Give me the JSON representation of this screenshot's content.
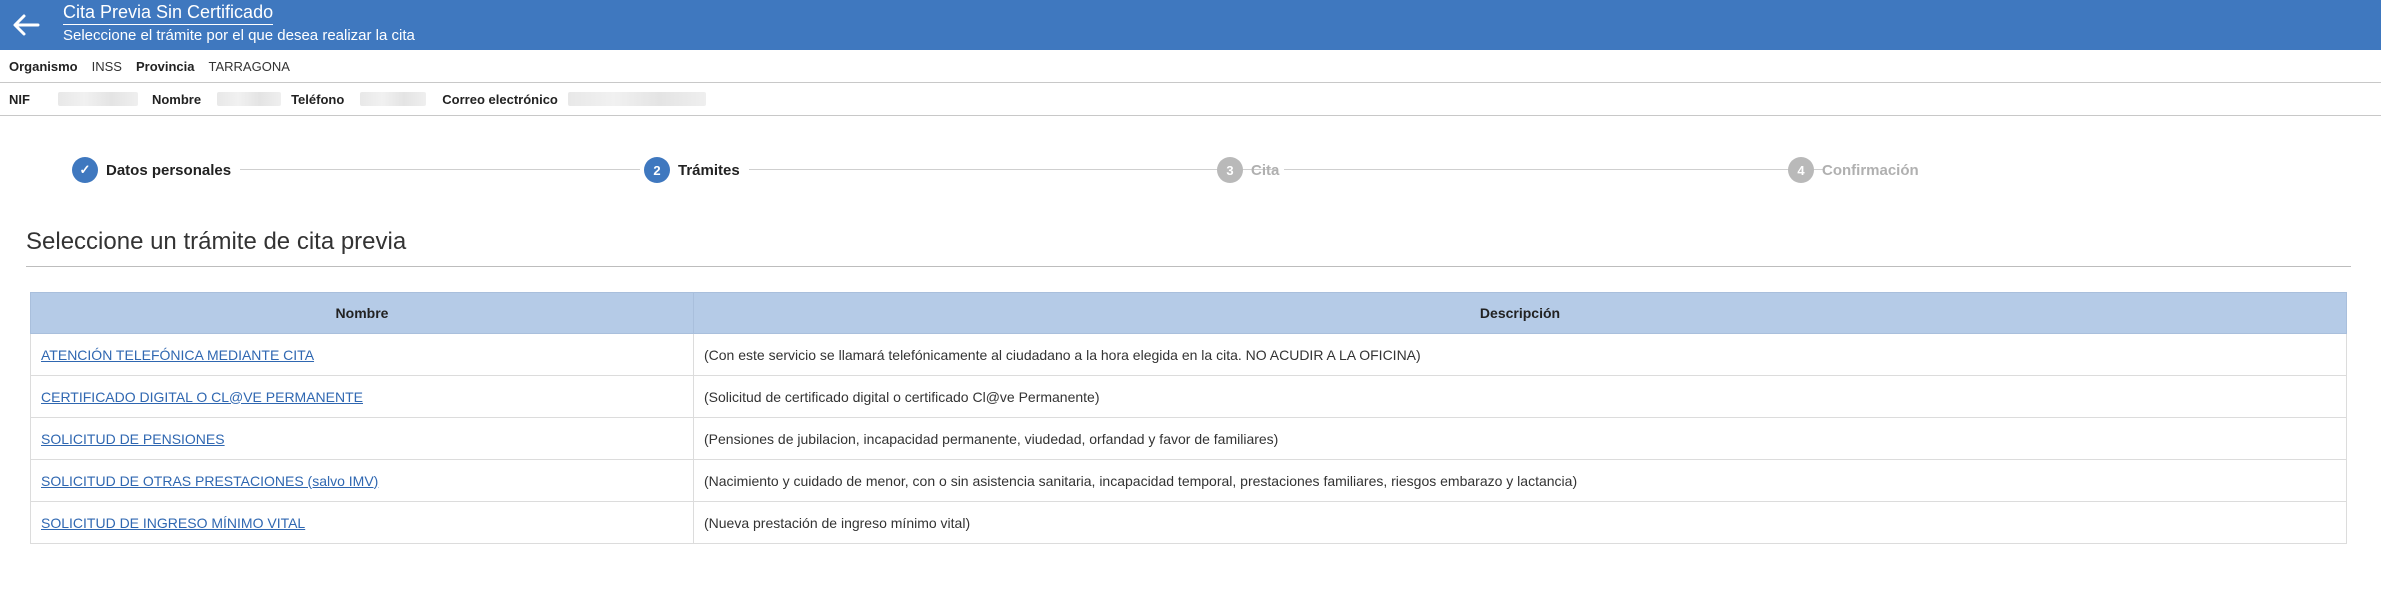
{
  "header": {
    "title": "Cita Previa Sin Certificado",
    "subtitle": "Seleccione el trámite por el que desea realizar la cita",
    "background_color": "#3f78bf"
  },
  "org_bar": {
    "organismo_label": "Organismo",
    "organismo_value": "INSS",
    "provincia_label": "Provincia",
    "provincia_value": "TARRAGONA"
  },
  "user_bar": {
    "nif_label": "NIF",
    "nombre_label": "Nombre",
    "telefono_label": "Teléfono",
    "correo_label": "Correo electrónico"
  },
  "stepper": {
    "steps": [
      {
        "number": "✓",
        "label": "Datos personales",
        "state": "completed"
      },
      {
        "number": "2",
        "label": "Trámites",
        "state": "current"
      },
      {
        "number": "3",
        "label": "Cita",
        "state": "pending"
      },
      {
        "number": "4",
        "label": "Confirmación",
        "state": "pending"
      }
    ]
  },
  "main": {
    "section_title": "Seleccione un trámite de cita previa",
    "table": {
      "headers": [
        "Nombre",
        "Descripción"
      ],
      "rows": [
        {
          "name": "ATENCIÓN TELEFÓNICA MEDIANTE CITA",
          "description": "(Con este servicio se llamará telefónicamente al ciudadano a la hora elegida en la cita. NO ACUDIR A LA OFICINA)"
        },
        {
          "name": "CERTIFICADO DIGITAL O CL@VE PERMANENTE",
          "description": "(Solicitud de certificado digital o certificado Cl@ve Permanente)"
        },
        {
          "name": "SOLICITUD DE PENSIONES",
          "description": "(Pensiones de jubilacion, incapacidad permanente, viudedad, orfandad y favor de familiares)"
        },
        {
          "name": "SOLICITUD DE OTRAS PRESTACIONES (salvo IMV)",
          "description": "(Nacimiento y cuidado de menor, con o sin asistencia sanitaria, incapacidad temporal, prestaciones familiares, riesgos embarazo y lactancia)"
        },
        {
          "name": "SOLICITUD DE INGRESO MÍNIMO VITAL",
          "description": "(Nueva prestación de ingreso mínimo vital)"
        }
      ]
    }
  },
  "colors": {
    "accent": "#3f78bf",
    "table_header": "#b5cbe7",
    "link": "#2f67b1",
    "inactive_step": "#b9b9b9"
  }
}
